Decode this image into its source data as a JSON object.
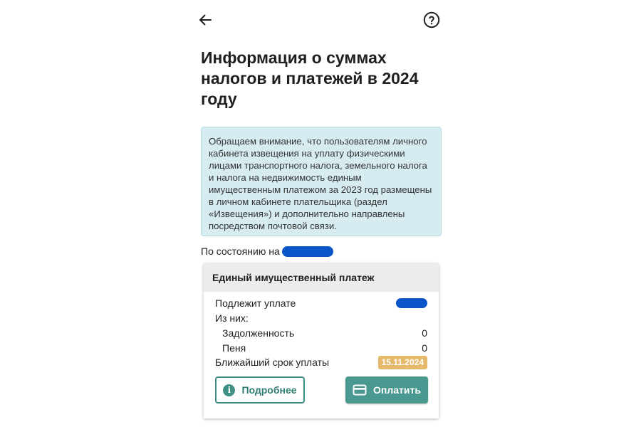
{
  "header": {
    "back_icon": "arrow-left-icon",
    "help_icon": "help-circle-icon"
  },
  "page": {
    "title": "Информация о суммах налогов и платежей в 2024 году"
  },
  "notice": {
    "text": "Обращаем внимание, что пользователям личного кабинета извещения на уплату физическими лицами транспортного налога, земельного налога и налога на недвижимость единым имущественным платежом за 2023 год размещены в личном кабинете плательщика (раздел «Извещения») и дополнительно направлены посредством почтовой связи.",
    "background": "#d6ecf1"
  },
  "status": {
    "label": "По состоянию на"
  },
  "card": {
    "title": "Единый имущественный платеж",
    "rows": {
      "due": {
        "label": "Подлежит уплате"
      },
      "of_them": {
        "label": "Из них:"
      },
      "debt": {
        "label": "Задолженность",
        "value": "0"
      },
      "penalty": {
        "label": "Пеня",
        "value": "0"
      },
      "deadline": {
        "label": "Ближайший срок уплаты",
        "value": "15.11.2024"
      }
    },
    "details_button": {
      "label": "Подробнее",
      "icon": "info-icon"
    },
    "pay_button": {
      "label": "Оплатить",
      "icon": "credit-card-icon"
    }
  },
  "colors": {
    "accent": "#4a9990",
    "deadline_badge": "#e6b86a",
    "redaction": "#0a55c8"
  }
}
